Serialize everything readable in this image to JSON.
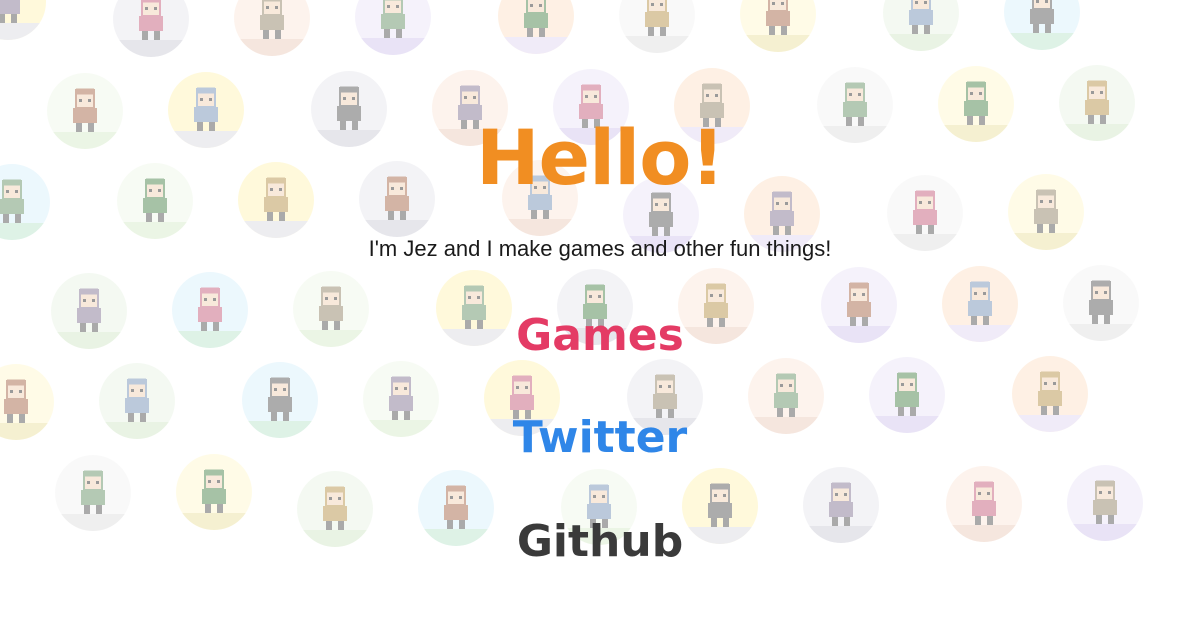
{
  "header": {
    "greeting": "Hello!",
    "tagline": "I'm Jez and I make games and other fun things!"
  },
  "links": {
    "games": "Games",
    "twitter": "Twitter",
    "github": "Github"
  },
  "colors": {
    "greeting": "#f18e22",
    "games": "#e43b65",
    "twitter": "#2f86e8",
    "github": "#3a3a3a"
  },
  "background_icons": [
    "green-blob-icon",
    "bowler-hat-man-icon",
    "stick-figure-icon",
    "one-eyed-monster-icon",
    "pixel-boy-icon",
    "girl-icon",
    "potted-plant-icon",
    "frog-icon",
    "duck-icon",
    "blonde-kid-icon",
    "robot-icon",
    "ghost-icon",
    "ukulele-icon",
    "blue-creature-icon"
  ]
}
